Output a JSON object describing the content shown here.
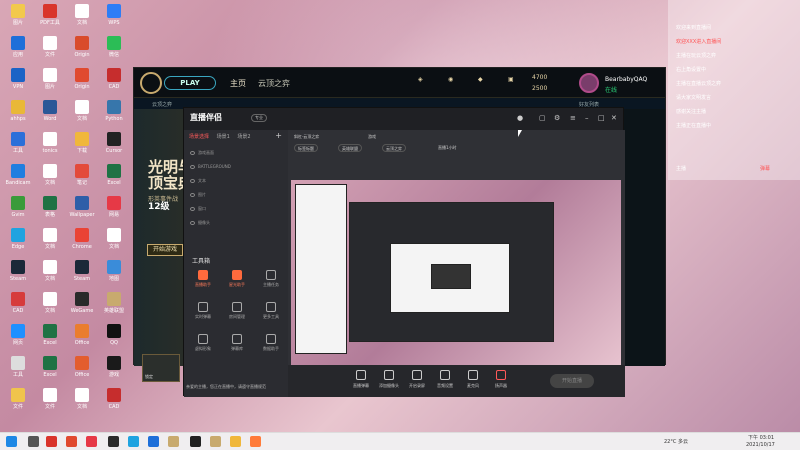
{
  "desktop": {
    "icons": [
      {
        "label": "图片",
        "color": "#f2c94c"
      },
      {
        "label": "PDF工具",
        "color": "#d9342b"
      },
      {
        "label": "文档",
        "color": "#ffffff"
      },
      {
        "label": "WPS",
        "color": "#2d7df6"
      },
      {
        "label": "应用",
        "color": "#1e6fd9"
      },
      {
        "label": "文件",
        "color": "#ffffff"
      },
      {
        "label": "Origin",
        "color": "#d94b2b"
      },
      {
        "label": "微信",
        "color": "#2bbd56"
      },
      {
        "label": "VPN",
        "color": "#1b63c6"
      },
      {
        "label": "图片",
        "color": "#ffffff"
      },
      {
        "label": "Origin",
        "color": "#e04a2f"
      },
      {
        "label": "CAD",
        "color": "#c62d2d"
      },
      {
        "label": "ahhps",
        "color": "#e9b838"
      },
      {
        "label": "Word",
        "color": "#2b5797"
      },
      {
        "label": "文档",
        "color": "#ffffff"
      },
      {
        "label": "Python",
        "color": "#3776ab"
      },
      {
        "label": "工具",
        "color": "#2b6fd9"
      },
      {
        "label": "tonics",
        "color": "#ffffff"
      },
      {
        "label": "下载",
        "color": "#f0b73b"
      },
      {
        "label": "Cursor",
        "color": "#222222"
      },
      {
        "label": "Bandicam",
        "color": "#1f7ee0"
      },
      {
        "label": "文档",
        "color": "#ffffff"
      },
      {
        "label": "笔记",
        "color": "#e34a3a"
      },
      {
        "label": "Excel",
        "color": "#1f7244"
      },
      {
        "label": "Gvim",
        "color": "#3a9b3a"
      },
      {
        "label": "表格",
        "color": "#1f7244"
      },
      {
        "label": "Wallpaper",
        "color": "#2e5ea8"
      },
      {
        "label": "网易",
        "color": "#e63946"
      },
      {
        "label": "Edge",
        "color": "#1fa3e0"
      },
      {
        "label": "文档",
        "color": "#ffffff"
      },
      {
        "label": "Chrome",
        "color": "#ea4335"
      },
      {
        "label": "文档",
        "color": "#ffffff"
      },
      {
        "label": "Steam",
        "color": "#1b2838"
      },
      {
        "label": "文档",
        "color": "#ffffff"
      },
      {
        "label": "Steam",
        "color": "#1b2838"
      },
      {
        "label": "地图",
        "color": "#3a8cd9"
      },
      {
        "label": "CAD",
        "color": "#d63b3b"
      },
      {
        "label": "文档",
        "color": "#ffffff"
      },
      {
        "label": "WeGame",
        "color": "#2a2a2a"
      },
      {
        "label": "英雄联盟",
        "color": "#c8aa6e"
      },
      {
        "label": "网页",
        "color": "#1e90ff"
      },
      {
        "label": "Excel",
        "color": "#1f7244"
      },
      {
        "label": "Office",
        "color": "#ea7d2e"
      },
      {
        "label": "QQ",
        "color": "#111111"
      },
      {
        "label": "工具",
        "color": "#dddddd"
      },
      {
        "label": "Excel",
        "color": "#1f7244"
      },
      {
        "label": "Office",
        "color": "#e35d2e"
      },
      {
        "label": "游戏",
        "color": "#1a1a1a"
      },
      {
        "label": "文件",
        "color": "#f0c44c"
      },
      {
        "label": "文件",
        "color": "#ffffff"
      },
      {
        "label": "文档",
        "color": "#ffffff"
      },
      {
        "label": "CAD",
        "color": "#c62d2d"
      }
    ]
  },
  "game": {
    "play_label": "PLAY",
    "nav_home": "主页",
    "nav_tft": "云顶之弈",
    "sub_left": "云顶之弈",
    "sub_right": "好友列表",
    "icons": [
      "主页",
      "藏品",
      "战利品",
      "商店"
    ],
    "hero_line1": "光明与",
    "hero_line2": "顶宝典",
    "hero_sub": "形英事件战",
    "level": "12级",
    "start_btn": "开始游戏",
    "be": "4700",
    "rp": "2500",
    "username": "BearbabyQAQ",
    "status": "在线",
    "card_label": "锁定"
  },
  "live": {
    "logo": "直播伴侣",
    "badge": "专业",
    "tabs": [
      "场景选择",
      "场景1",
      "场景2"
    ],
    "sources": [
      "游戏画面",
      "BATTLEGROUND",
      "文本",
      "图片",
      "窗口",
      "摄像头"
    ],
    "tools_heading": "工具箱",
    "tools": [
      {
        "label": "直播助手",
        "hot": true
      },
      {
        "label": "星光助手",
        "hot": true
      },
      {
        "label": "主播任务",
        "hot": false
      },
      {
        "label": "实时弹幕",
        "hot": false
      },
      {
        "label": "房间管理",
        "hot": false
      },
      {
        "label": "更多工具",
        "hot": false
      },
      {
        "label": "虚拟形象",
        "hot": false
      },
      {
        "label": "弹幕库",
        "hot": false
      },
      {
        "label": "数据助手",
        "hot": false
      }
    ],
    "notice": "亲爱的主播，您正在直播中，请遵守直播规范",
    "room_title": "斜杠·云顶之弈",
    "category": "游戏",
    "tags": [
      "标签标题",
      "英雄联盟",
      "云顶之弈"
    ],
    "stats": "直播1小时",
    "bottom": [
      "直播弹幕",
      "添加摄像头",
      "开启录屏",
      "音频设置",
      "麦克风",
      "扬声器"
    ],
    "start_label": "开始直播"
  },
  "chat": {
    "lines": [
      {
        "text": "欢迎来到直播间",
        "color": "white"
      },
      {
        "text": "欢迎XXX进入直播间",
        "color": "red"
      },
      {
        "text": "主播在玩云顶之弈",
        "color": "white"
      },
      {
        "text": "右上角设置中",
        "color": "white"
      },
      {
        "text": "主播在直播云顶之弈",
        "color": "white"
      },
      {
        "text": "请大家文明发言",
        "color": "white"
      },
      {
        "text": "感谢关注主播",
        "color": "white"
      },
      {
        "text": "主播正在直播中",
        "color": "white"
      }
    ],
    "footer_left": "主播",
    "footer_right": "弹幕"
  },
  "taskbar": {
    "time": "下午 03:01",
    "date": "2021/10/17",
    "weather": "22°C 多云"
  }
}
